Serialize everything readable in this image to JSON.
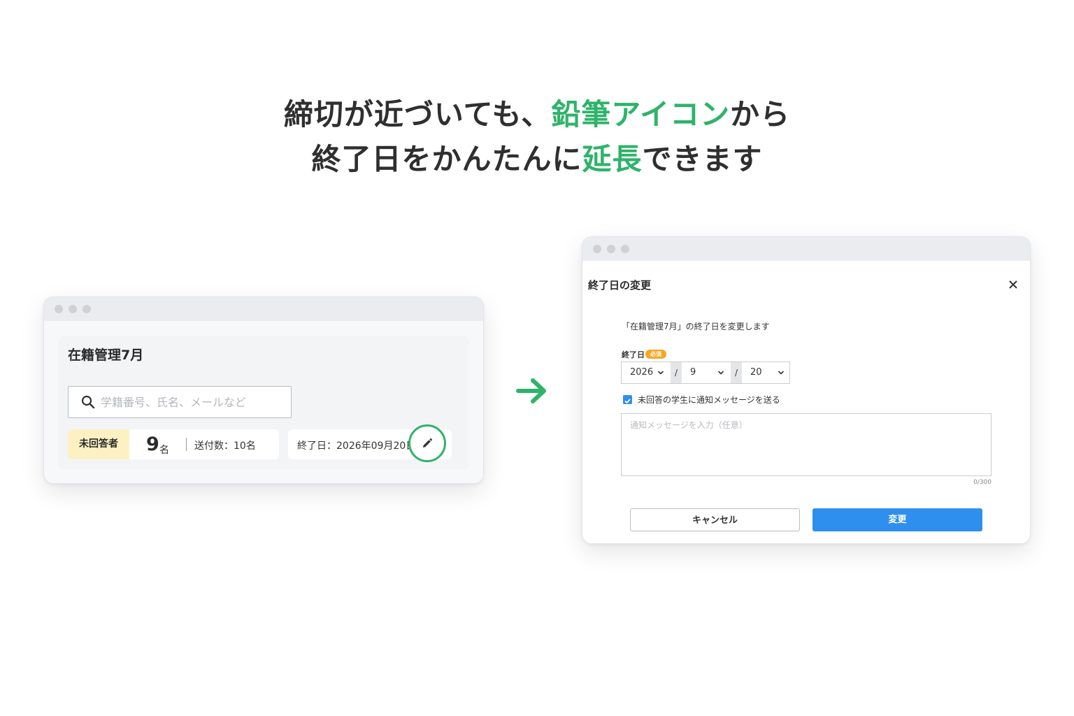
{
  "headline": {
    "line1_before": "締切が近づいても、",
    "line1_accent": "鉛筆アイコン",
    "line1_after": "から",
    "line2_before": "終了日をかんたんに",
    "line2_accent": "延長",
    "line2_after": "できます"
  },
  "colors": {
    "accent_green": "#2fb36a",
    "primary_blue": "#2f8fee",
    "badge_yellow": "#fdf1c4",
    "required_orange": "#f5a623"
  },
  "left_window": {
    "page_title": "在籍管理7月",
    "search": {
      "placeholder": "学籍番号、氏名、メールなど",
      "icon": "search-icon"
    },
    "status_badge": "未回答者",
    "count": "9",
    "count_unit": "名",
    "sent_label": "送付数：10名",
    "end_date_label": "終了日：2026年09月20日",
    "edit_icon": "pencil-icon"
  },
  "arrow_icon": "arrow-right-icon",
  "dialog": {
    "title": "終了日の変更",
    "close_icon": "close-icon",
    "description": "「在籍管理7月」の終了日を変更します",
    "field_label": "終了日",
    "required_badge": "必須",
    "year": "2026",
    "month": "9",
    "day": "20",
    "separator": "/",
    "notify_label": "未回答の学生に通知メッセージを送る",
    "notify_checked": true,
    "message_placeholder": "通知メッセージを入力（任意）",
    "char_count": "0/300",
    "cancel_label": "キャンセル",
    "submit_label": "変更"
  }
}
